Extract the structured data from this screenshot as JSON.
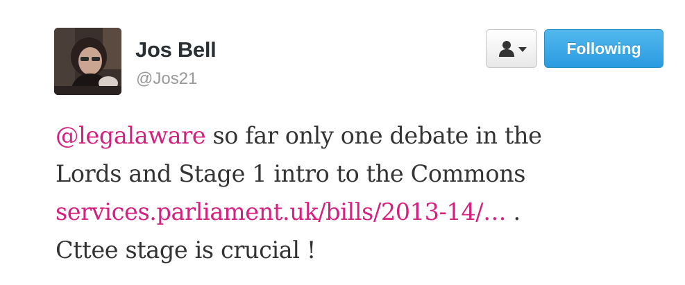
{
  "user": {
    "fullname": "Jos Bell",
    "username": "@Jos21"
  },
  "actions": {
    "user_menu_icon": "person-icon",
    "user_menu_caret": "caret-down-icon",
    "follow_label": "Following"
  },
  "tweet": {
    "mention": "@legalaware",
    "line1_rest": " so far only one debate in the",
    "line2": "Lords and Stage 1 intro to the Commons",
    "link": "services.parliament.uk/bills/2013-14/…",
    "line3_rest": " .",
    "line4": "Cttee stage is crucial !"
  },
  "colors": {
    "accent_link": "#d6207f",
    "follow_button": "#2a9be0",
    "text": "#333333",
    "muted": "#999999"
  }
}
